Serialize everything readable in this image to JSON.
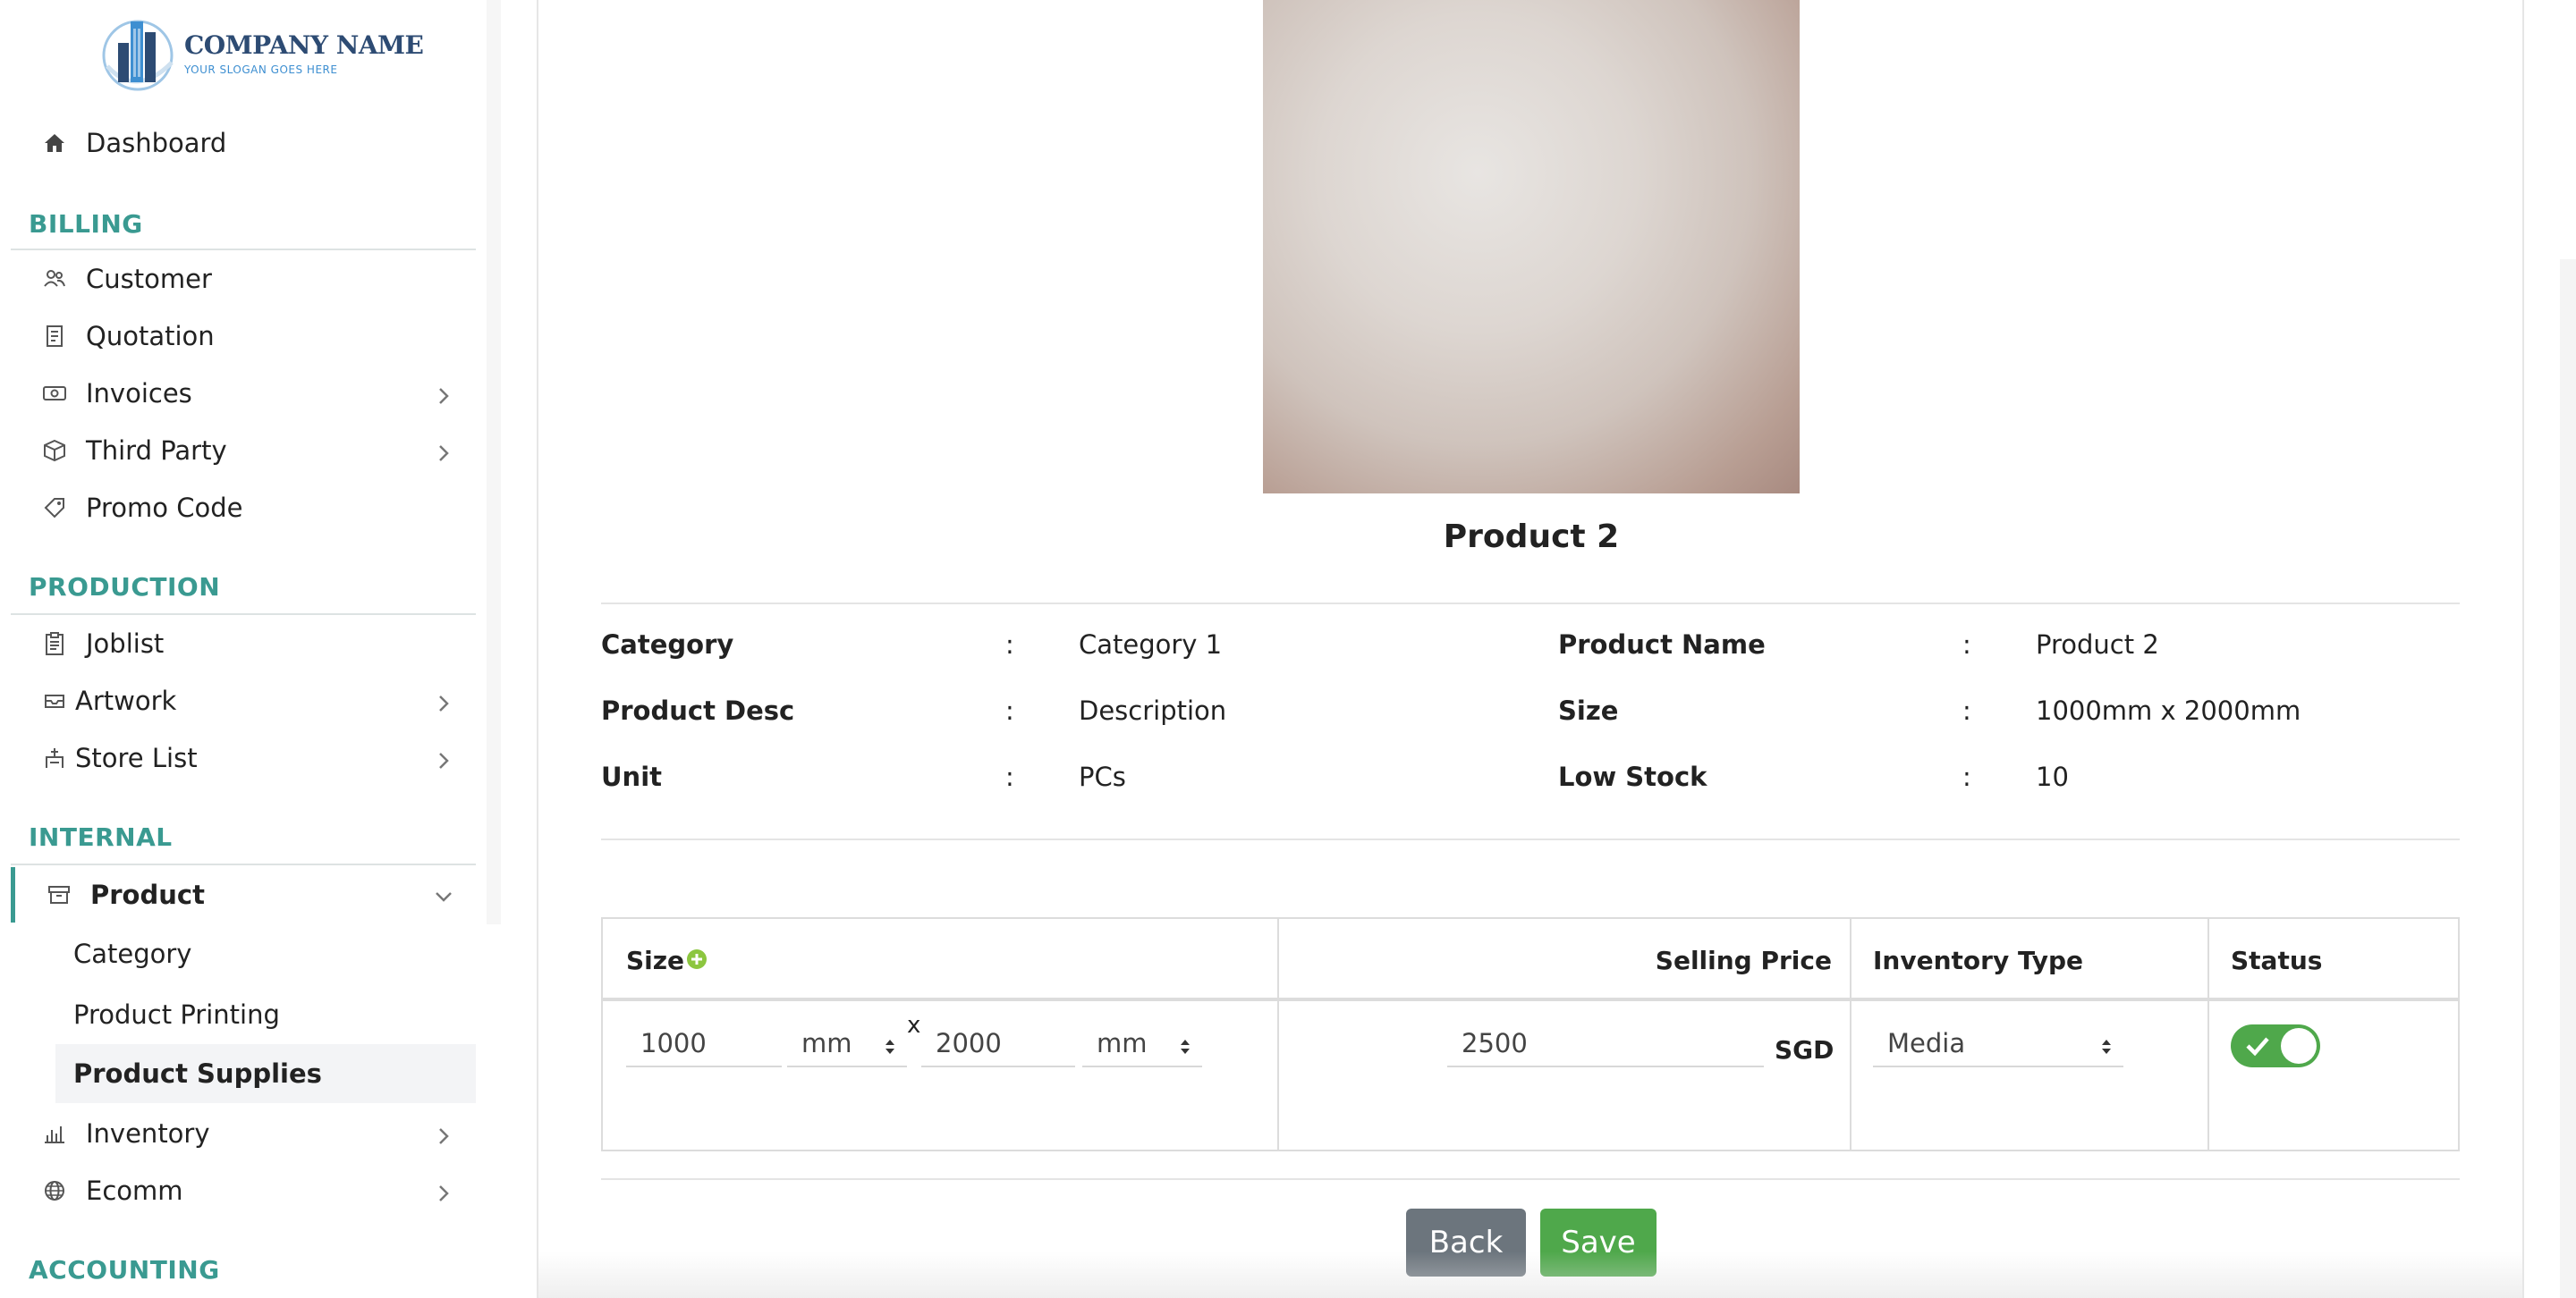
{
  "logo": {
    "name": "COMPANY NAME",
    "slogan": "YOUR SLOGAN GOES HERE"
  },
  "sidebar": {
    "dashboard": "Dashboard",
    "sections": {
      "billing": "BILLING",
      "production": "PRODUCTION",
      "internal": "INTERNAL",
      "accounting": "ACCOUNTING"
    },
    "billing_items": [
      "Customer",
      "Quotation",
      "Invoices",
      "Third Party",
      "Promo Code"
    ],
    "production_items": [
      "Joblist",
      "Artwork",
      "Store List"
    ],
    "internal": {
      "product": "Product",
      "sub": [
        "Category",
        "Product Printing",
        "Product Supplies"
      ],
      "inventory": "Inventory",
      "ecomm": "Ecomm"
    }
  },
  "product": {
    "title": "Product 2",
    "details": {
      "category_label": "Category",
      "category_value": "Category 1",
      "name_label": "Product Name",
      "name_value": "Product 2",
      "desc_label": "Product Desc",
      "desc_value": "Description",
      "size_label": "Size",
      "size_value": "1000mm x 2000mm",
      "unit_label": "Unit",
      "unit_value": "PCs",
      "low_label": "Low Stock",
      "low_value": "10",
      "colon": ":"
    }
  },
  "table": {
    "headers": {
      "size": "Size",
      "price": "Selling Price",
      "inventory": "Inventory Type",
      "status": "Status"
    },
    "row": {
      "width": "1000",
      "width_unit": "mm",
      "x": "x",
      "height": "2000",
      "height_unit": "mm",
      "price": "2500",
      "currency": "SGD",
      "inventory_type": "Media",
      "status_on": true
    }
  },
  "buttons": {
    "back": "Back",
    "save": "Save"
  },
  "colors": {
    "accent": "#3a9a91",
    "success": "#4fa84b",
    "secondary": "#6c757d",
    "logo_text": "#2d4b73"
  }
}
